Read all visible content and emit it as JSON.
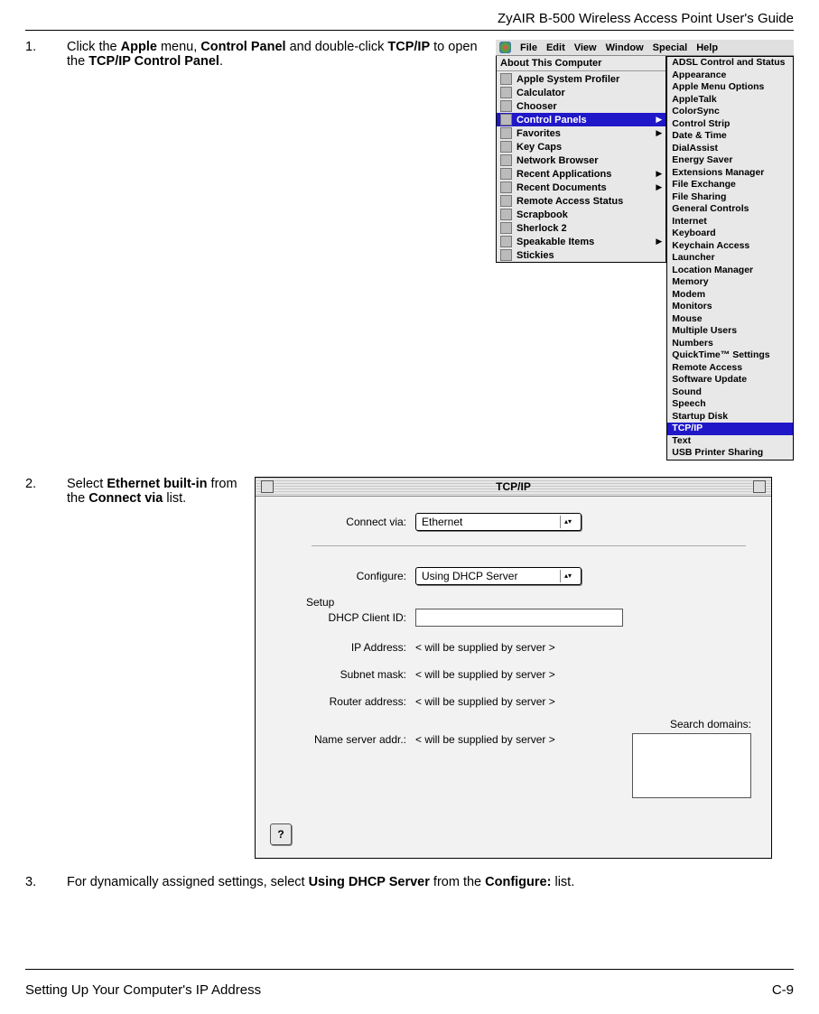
{
  "header": {
    "title": "ZyAIR B-500 Wireless Access Point User's Guide"
  },
  "step1": {
    "num": "1.",
    "pre": "Click the ",
    "b1": "Apple",
    "mid1": " menu, ",
    "b2": "Control Panel",
    "mid2": " and double-click ",
    "b3": "TCP/IP",
    "mid3": " to open the ",
    "b4": "TCP/IP Control Panel",
    "post": "."
  },
  "step2": {
    "num": "2.",
    "pre": "Select ",
    "b1": "Ethernet built-in",
    "mid1": " from the ",
    "b2": "Connect via",
    "post": " list."
  },
  "step3": {
    "num": "3.",
    "pre": "For dynamically assigned settings, select ",
    "b1": "Using DHCP Server",
    "mid1": " from the ",
    "b2": "Configure:",
    "post": " list."
  },
  "menubar": {
    "items": [
      "File",
      "Edit",
      "View",
      "Window",
      "Special",
      "Help"
    ]
  },
  "apple_menu": {
    "about": "About This Computer",
    "items": [
      {
        "label": "Apple System Profiler",
        "arrow": false
      },
      {
        "label": "Calculator",
        "arrow": false
      },
      {
        "label": "Chooser",
        "arrow": false
      },
      {
        "label": "Control Panels",
        "arrow": true,
        "selected": true
      },
      {
        "label": "Favorites",
        "arrow": true
      },
      {
        "label": "Key Caps",
        "arrow": false
      },
      {
        "label": "Network Browser",
        "arrow": false
      },
      {
        "label": "Recent Applications",
        "arrow": true
      },
      {
        "label": "Recent Documents",
        "arrow": true
      },
      {
        "label": "Remote Access Status",
        "arrow": false
      },
      {
        "label": "Scrapbook",
        "arrow": false
      },
      {
        "label": "Sherlock 2",
        "arrow": false
      },
      {
        "label": "Speakable Items",
        "arrow": true
      },
      {
        "label": "Stickies",
        "arrow": false
      }
    ]
  },
  "cp_menu": {
    "items": [
      "ADSL Control and Status",
      "Appearance",
      "Apple Menu Options",
      "AppleTalk",
      "ColorSync",
      "Control Strip",
      "Date & Time",
      "DialAssist",
      "Energy Saver",
      "Extensions Manager",
      "File Exchange",
      "File Sharing",
      "General Controls",
      "Internet",
      "Keyboard",
      "Keychain Access",
      "Launcher",
      "Location Manager",
      "Memory",
      "Modem",
      "Monitors",
      "Mouse",
      "Multiple Users",
      "Numbers",
      "QuickTime™ Settings",
      "Remote Access",
      "Software Update",
      "Sound",
      "Speech",
      "Startup Disk",
      "TCP/IP",
      "Text",
      "USB Printer Sharing"
    ],
    "selected": "TCP/IP"
  },
  "tcpip": {
    "title": "TCP/IP",
    "connect_label": "Connect via:",
    "connect_val": "Ethernet",
    "setup": "Setup",
    "configure_label": "Configure:",
    "configure_val": "Using DHCP Server",
    "dhcp_client_label": "DHCP Client ID:",
    "dhcp_client_val": "",
    "ip_label": "IP Address:",
    "ip_val": "< will be supplied by server >",
    "subnet_label": "Subnet mask:",
    "subnet_val": "< will be supplied by server >",
    "router_label": "Router address:",
    "router_val": "< will be supplied by server >",
    "ns_label": "Name server addr.:",
    "ns_val": "< will be supplied by server >",
    "search_label": "Search domains:",
    "help": "?"
  },
  "footer": {
    "left": "Setting Up Your Computer's IP Address",
    "right": "C-9"
  }
}
